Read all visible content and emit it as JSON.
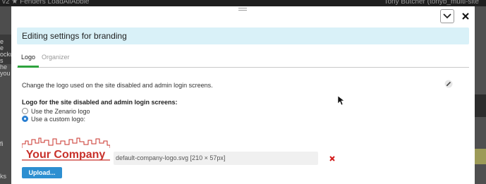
{
  "background": {
    "top_left_text": "v2  ★  Fenders   LoadAllAbble",
    "top_right_text": "Tony Butcher (tonyb_multi-site",
    "left_fragments": [
      "e",
      "e",
      "ockup",
      "s",
      "he",
      "you"
    ],
    "left_lower_fragments": [
      "fi",
      "ks"
    ]
  },
  "modal": {
    "title": "Editing settings for branding",
    "tabs": [
      {
        "label": "Logo",
        "active": true
      },
      {
        "label": "Organizer",
        "active": false
      }
    ],
    "description": "Change the logo used on the site disabled and admin login screens.",
    "logo_field": {
      "label": "Logo for the site disabled and admin login screens:",
      "options": [
        {
          "label": "Use the Zenario logo",
          "checked": false
        },
        {
          "label": "Use a custom logo:",
          "checked": true
        }
      ],
      "preview_text": "Your Company",
      "filename": "default-company-logo.svg [210 × 57px]",
      "upload_label": "Upload..."
    }
  },
  "colors": {
    "title_bar_bg": "#d9f1f8",
    "tab_underline": "#2ea33e",
    "upload_button": "#2d8fd1",
    "logo_red": "#c8302a",
    "delete_red": "#d31c1c"
  },
  "icons": {
    "collapse": "chevron-down-icon",
    "close": "close-icon",
    "edit": "pencil-icon",
    "delete": "delete-x-icon",
    "drag": "drag-handle-icon",
    "cursor": "mouse-cursor-icon"
  }
}
